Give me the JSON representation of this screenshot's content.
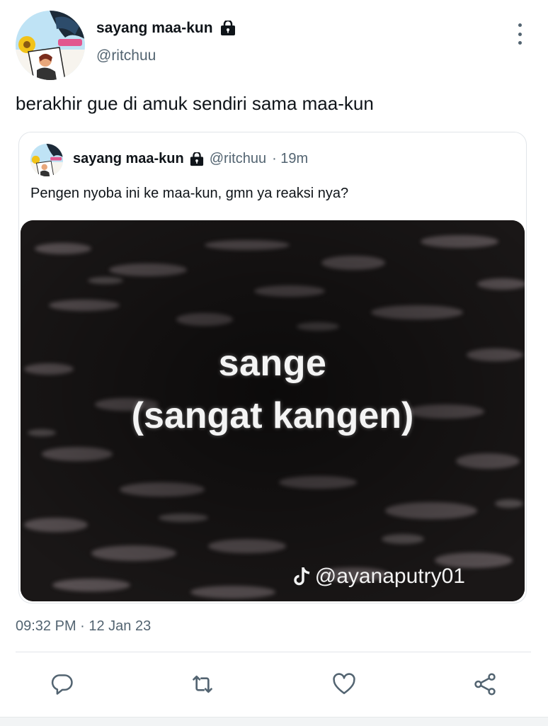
{
  "tweet": {
    "author": {
      "name": "sayang maa-kun",
      "handle": "@ritchuu"
    },
    "text": "berakhir gue di amuk sendiri sama maa-kun",
    "timestamp": "09:32 PM · 12 Jan 23"
  },
  "quote": {
    "author": {
      "name": "sayang maa-kun",
      "handle": "@ritchuu",
      "time": "· 19m"
    },
    "text": "Pengen nyoba ini ke maa-kun, gmn ya reaksi nya?",
    "media": {
      "line1": "sange",
      "line2": "(sangat kangen)",
      "watermark": "@ayanaputry01"
    }
  },
  "icons": {
    "lock": "lock-icon",
    "more": "more-vertical-icon",
    "reply": "reply-icon",
    "retweet": "retweet-icon",
    "like": "heart-icon",
    "share": "share-icon",
    "tiktok": "tiktok-icon"
  },
  "colors": {
    "text": "#0f1419",
    "secondary": "#536471",
    "border": "#e1e5e9"
  }
}
